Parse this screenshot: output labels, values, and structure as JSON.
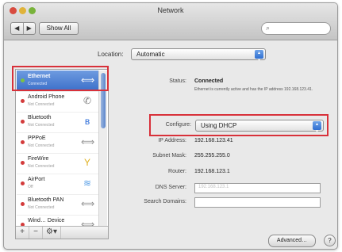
{
  "window": {
    "title": "Network",
    "nav_back": "◀",
    "nav_forward": "▶",
    "show_all": "Show All",
    "search_icon": "search-icon"
  },
  "location": {
    "label": "Location:",
    "value": "Automatic"
  },
  "sidebar": {
    "items": [
      {
        "name": "Ethernet",
        "status": "Connected",
        "icon": "ethernet-icon",
        "dot": "#7dc242",
        "selected": true
      },
      {
        "name": "Android Phone",
        "status": "Not Connected",
        "icon": "phone-icon",
        "dot": "#d33b3b"
      },
      {
        "name": "Bluetooth",
        "status": "Not Connected",
        "icon": "bluetooth-icon",
        "dot": "#d33b3b"
      },
      {
        "name": "PPPoE",
        "status": "Not Connected",
        "icon": "ethernet-icon",
        "dot": "#d33b3b"
      },
      {
        "name": "FireWire",
        "status": "Not Connected",
        "icon": "firewire-icon",
        "dot": "#d33b3b"
      },
      {
        "name": "AirPort",
        "status": "Off",
        "icon": "wifi-icon",
        "dot": "#d33b3b"
      },
      {
        "name": "Bluetooth PAN",
        "status": "Not Connected",
        "icon": "ethernet-icon",
        "dot": "#d33b3b"
      },
      {
        "name": "Wind… Device",
        "status": "Not Connected",
        "icon": "ethernet-icon",
        "dot": "#d33b3b"
      }
    ],
    "footer": [
      "+",
      "−",
      "⚙▾"
    ]
  },
  "detail": {
    "status_label": "Status:",
    "status_value": "Connected",
    "status_desc": "Ethernet is currently active and has the IP address 192.168.123.41.",
    "configure_label": "Configure:",
    "configure_value": "Using DHCP",
    "ip_label": "IP Address:",
    "ip_value": "192.168.123.41",
    "subnet_label": "Subnet Mask:",
    "subnet_value": "255.255.255.0",
    "router_label": "Router:",
    "router_value": "192.168.123.1",
    "dns_label": "DNS Server:",
    "dns_value": "192.168.123.1",
    "search_domains_label": "Search Domains:",
    "search_domains_value": ""
  },
  "buttons": {
    "advanced": "Advanced…",
    "help": "?"
  },
  "colors": {
    "highlight": "#d8313a",
    "select_accent": "#2f6fd1"
  }
}
